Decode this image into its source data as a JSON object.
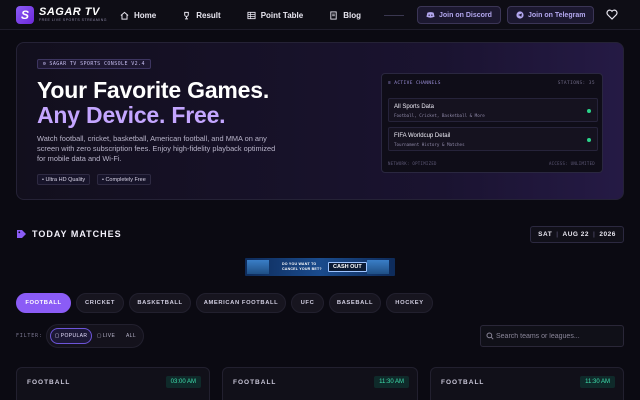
{
  "brand": {
    "name": "SAGAR TV",
    "tagline": "FREE LIVE SPORTS STREAMING"
  },
  "nav": {
    "links": [
      {
        "label": "Home",
        "icon": "home-icon"
      },
      {
        "label": "Result",
        "icon": "trophy-icon"
      },
      {
        "label": "Point Table",
        "icon": "table-icon"
      },
      {
        "label": "Blog",
        "icon": "document-icon"
      }
    ],
    "discord_label": "Join on Discord",
    "telegram_label": "Join on Telegram"
  },
  "hero": {
    "badge": "SAGAR TV SPORTS CONSOLE V2.4",
    "title_line1": "Your Favorite Games.",
    "title_line2": "Any Device. Free.",
    "description": "Watch football, cricket, basketball, American football, and MMA on any screen with zero subscription fees. Enjoy high-fidelity playback optimized for mobile data and Wi-Fi.",
    "tags": [
      "• Ultra HD Quality",
      "• Completely Free"
    ],
    "console": {
      "header": "≡ ACTIVE CHANNELS",
      "stations": "STATIONS: 35",
      "items": [
        {
          "title": "All Sports Data",
          "subtitle": "Football, Cricket, Basketball & More"
        },
        {
          "title": "FIFA Worldcup Detail",
          "subtitle": "Tournament History & Matches"
        }
      ],
      "footer_left": "NETWORK: OPTIMIZED",
      "footer_right": "ACCESS: UNLIMITED"
    }
  },
  "matches": {
    "title": "TODAY MATCHES",
    "date": {
      "day": "SAT",
      "monthday": "AUG 22",
      "year": "2026"
    },
    "banner": {
      "text_line1": "DO YOU WANT TO",
      "text_line2": "CANCEL YOUR BET?",
      "cta": "CASH OUT"
    },
    "sports": [
      "FOOTBALL",
      "CRICKET",
      "BASKETBALL",
      "AMERICAN FOOTBALL",
      "UFC",
      "BASEBALL",
      "HOCKEY"
    ],
    "active_sport": "FOOTBALL",
    "filter_label": "FILTER:",
    "filters": [
      "POPULAR",
      "LIVE",
      "ALL"
    ],
    "search_placeholder": "Search teams or leagues...",
    "cards": [
      {
        "sport": "FOOTBALL",
        "time": "03:00 AM"
      },
      {
        "sport": "FOOTBALL",
        "time": "11:30 AM"
      },
      {
        "sport": "FOOTBALL",
        "time": "11:30 AM"
      }
    ]
  },
  "colors": {
    "accent": "#8b5cf6",
    "live_green": "#3fe0ae",
    "background": "#0b0a12"
  }
}
